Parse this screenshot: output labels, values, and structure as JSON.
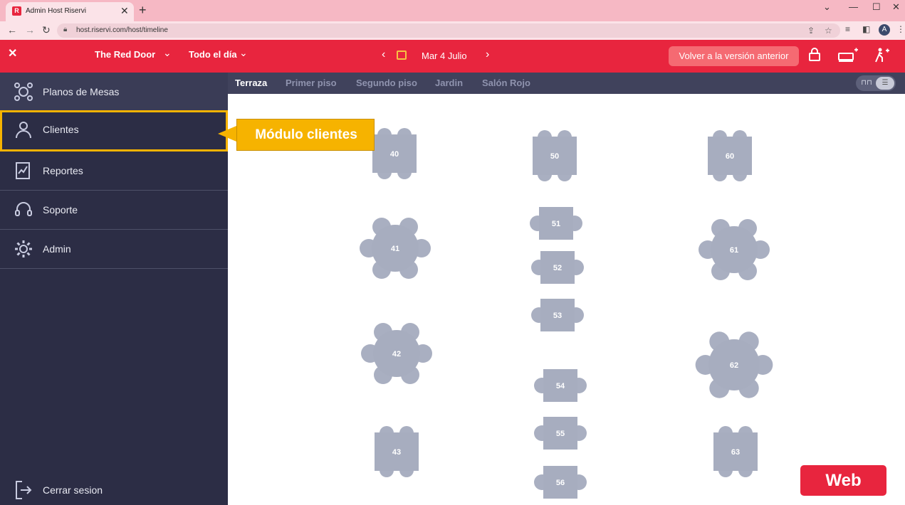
{
  "browser": {
    "tab_title": "Admin Host Riservi",
    "url": "host.riservi.com/host/timeline",
    "profile_initial": "A"
  },
  "header": {
    "restaurant": "The Red Door",
    "shift": "Todo el día",
    "date": "Mar 4 Julio",
    "old_version_button": "Volver a la versión anterior"
  },
  "sidebar": {
    "items": [
      {
        "label": "Planos de Mesas",
        "icon": "floor-plan-icon"
      },
      {
        "label": "Clientes",
        "icon": "user-icon"
      },
      {
        "label": "Reportes",
        "icon": "reports-icon"
      },
      {
        "label": "Soporte",
        "icon": "headset-icon"
      },
      {
        "label": "Admin",
        "icon": "gear-icon"
      }
    ],
    "logout_label": "Cerrar sesion"
  },
  "floors": {
    "tabs": [
      "Terraza",
      "Primer piso",
      "Segundo piso",
      "Jardin",
      "Salón Rojo"
    ],
    "active": "Terraza"
  },
  "tables": [
    {
      "id": "40",
      "shape": "rect4"
    },
    {
      "id": "50",
      "shape": "rect4"
    },
    {
      "id": "60",
      "shape": "rect4"
    },
    {
      "id": "41",
      "shape": "round6"
    },
    {
      "id": "51",
      "shape": "rect2"
    },
    {
      "id": "52",
      "shape": "rect2"
    },
    {
      "id": "53",
      "shape": "rect2"
    },
    {
      "id": "61",
      "shape": "round6"
    },
    {
      "id": "42",
      "shape": "round6"
    },
    {
      "id": "62",
      "shape": "round6"
    },
    {
      "id": "54",
      "shape": "rect2"
    },
    {
      "id": "55",
      "shape": "rect2"
    },
    {
      "id": "56",
      "shape": "rect2"
    },
    {
      "id": "43",
      "shape": "rect4"
    },
    {
      "id": "63",
      "shape": "rect4"
    }
  ],
  "annotations": {
    "callout": "Módulo clientes",
    "badge": "Web"
  },
  "colors": {
    "brand_red": "#e8253e",
    "sidebar_bg": "#2c2d45",
    "highlight": "#f6b300",
    "table_fill": "#a7adbf"
  }
}
